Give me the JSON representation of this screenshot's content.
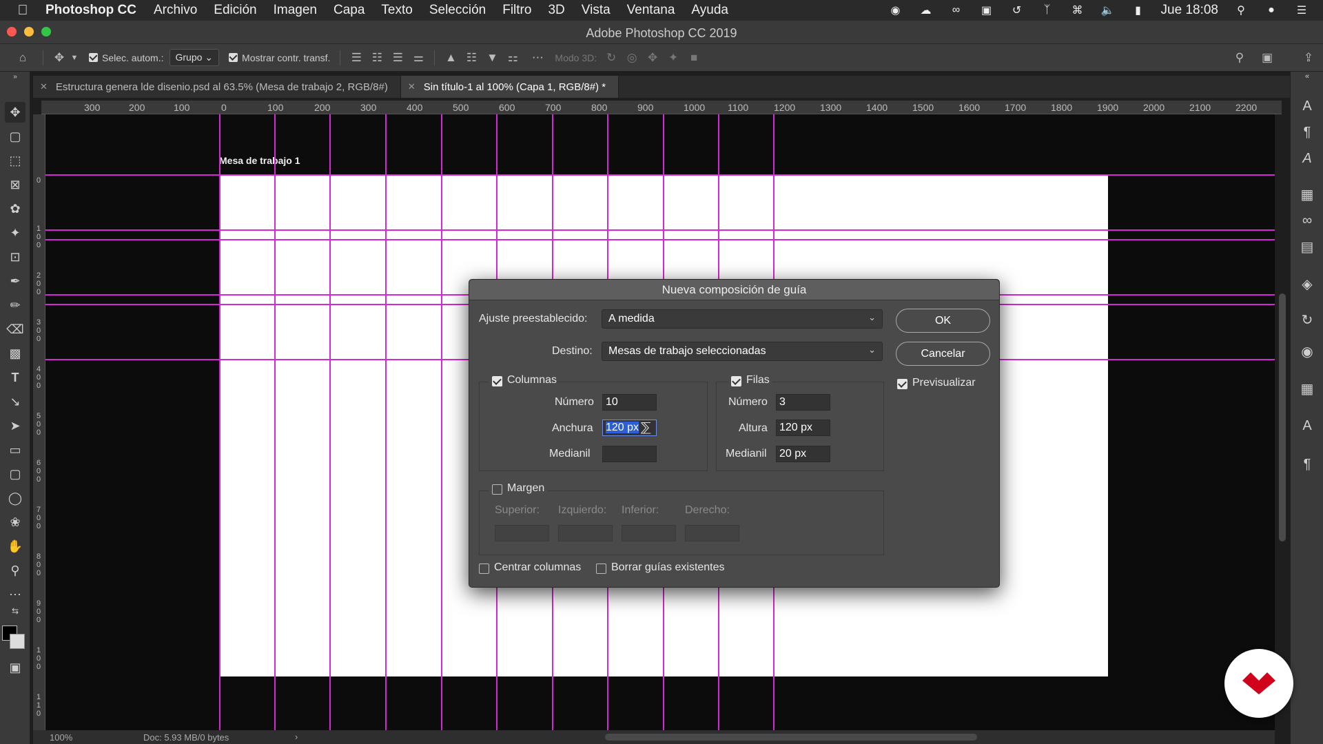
{
  "menubar": {
    "app_name": "Photoshop CC",
    "items": [
      "Archivo",
      "Edición",
      "Imagen",
      "Capa",
      "Texto",
      "Selección",
      "Filtro",
      "3D",
      "Vista",
      "Ventana",
      "Ayuda"
    ],
    "clock": "Jue 18:08",
    "status_icons": [
      "record-icon",
      "cloud-icon",
      "creative-cloud-icon",
      "display-icon",
      "time-machine-icon",
      "bluetooth-icon",
      "wifi-icon",
      "volume-icon",
      "battery-icon",
      "search-icon",
      "siri-icon",
      "control-center-icon"
    ]
  },
  "window": {
    "title": "Adobe Photoshop CC 2019"
  },
  "options_bar": {
    "auto_select_label": "Selec. autom.:",
    "auto_select_checked": true,
    "auto_select_mode": "Grupo",
    "show_transform_label": "Mostrar contr. transf.",
    "show_transform_checked": true,
    "mode_3d_label": "Modo 3D:"
  },
  "tabs": [
    {
      "label": "Estructura genera lde disenio.psd al 63.5% (Mesa de trabajo 2, RGB/8#)",
      "active": false
    },
    {
      "label": "Sin título-1 al 100% (Capa 1, RGB/8#) *",
      "active": true
    }
  ],
  "ruler_h": [
    "300",
    "200",
    "100",
    "0",
    "100",
    "200",
    "300",
    "400",
    "500",
    "600",
    "700",
    "800",
    "900",
    "1000",
    "1100",
    "1200",
    "1300",
    "1400",
    "1500",
    "1600",
    "1700",
    "1800",
    "1900",
    "2000",
    "2100",
    "2200"
  ],
  "ruler_v": [
    "0",
    "1 0 0",
    "2 0 0",
    "3 0 0",
    "4 0 0",
    "5 0 0",
    "6 0 0",
    "7 0 0",
    "8 0 0",
    "9 0 0",
    "1 0 0",
    "1 1 0"
  ],
  "canvas": {
    "artboard_label": "Mesa de trabajo 1"
  },
  "status": {
    "zoom": "100%",
    "doc": "Doc: 5.93 MB/0 bytes",
    "arrow": "›"
  },
  "dialog": {
    "title": "Nueva composición de guía",
    "preset_label": "Ajuste preestablecido:",
    "preset_value": "A medida",
    "target_label": "Destino:",
    "target_value": "Mesas de trabajo seleccionadas",
    "ok_label": "OK",
    "cancel_label": "Cancelar",
    "preview_label": "Previsualizar",
    "preview_checked": true,
    "columns": {
      "label": "Columnas",
      "checked": true,
      "number_label": "Número",
      "number_value": "10",
      "width_label": "Anchura",
      "width_value": "120 px",
      "gutter_label": "Medianil",
      "gutter_value": ""
    },
    "rows": {
      "label": "Filas",
      "checked": true,
      "number_label": "Número",
      "number_value": "3",
      "height_label": "Altura",
      "height_value": "120 px",
      "gutter_label": "Medianil",
      "gutter_value": "20 px"
    },
    "margin": {
      "label": "Margen",
      "checked": false,
      "top_label": "Superior:",
      "left_label": "Izquierdo:",
      "bottom_label": "Inferior:",
      "right_label": "Derecho:"
    },
    "center_columns_label": "Centrar columnas",
    "center_columns_checked": false,
    "clear_guides_label": "Borrar guías existentes",
    "clear_guides_checked": false
  },
  "colors": {
    "guide": "#d627d6",
    "accent_selection": "#2d5ed6",
    "brand_badge": "#d0021b"
  }
}
